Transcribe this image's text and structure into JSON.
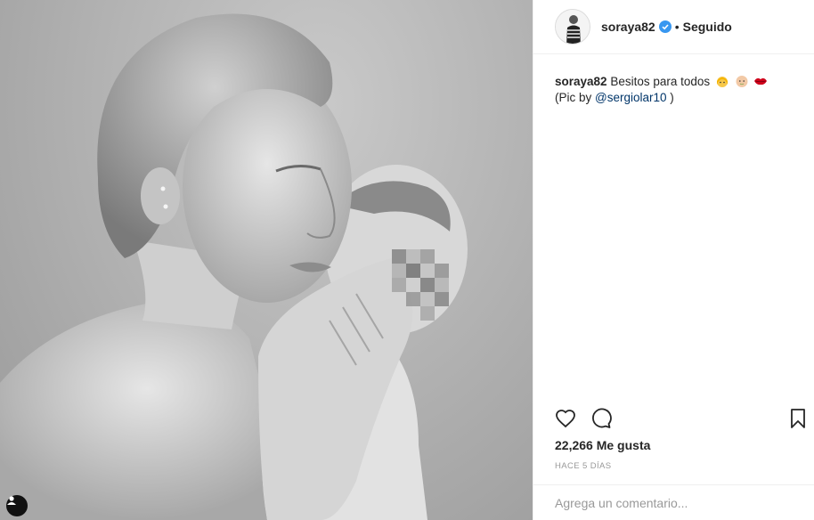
{
  "post": {
    "photo_alt": "Black and white photo",
    "tag_icon": "person-tag-icon"
  },
  "header": {
    "username": "soraya82",
    "verified_icon": "verified-badge-icon",
    "separator": "•",
    "follow_state": "Seguido"
  },
  "caption": {
    "username": "soraya82",
    "text": "Besitos para todos",
    "emojis": [
      "girl-emoji",
      "baby-emoji",
      "kiss-lips-emoji"
    ],
    "credit_prefix": "(Pic by ",
    "credit_mention": "@sergiolar10",
    "credit_suffix": " )"
  },
  "actions": {
    "like_icon": "heart-icon",
    "comment_icon": "comment-icon",
    "save_icon": "bookmark-icon"
  },
  "likes": "22,266 Me gusta",
  "time": "HACE 5 DÍAS",
  "comment": {
    "placeholder": "Agrega un comentario..."
  },
  "colors": {
    "mention": "#003569",
    "verified": "#3897f0",
    "muted": "#999999",
    "border": "#efefef"
  }
}
